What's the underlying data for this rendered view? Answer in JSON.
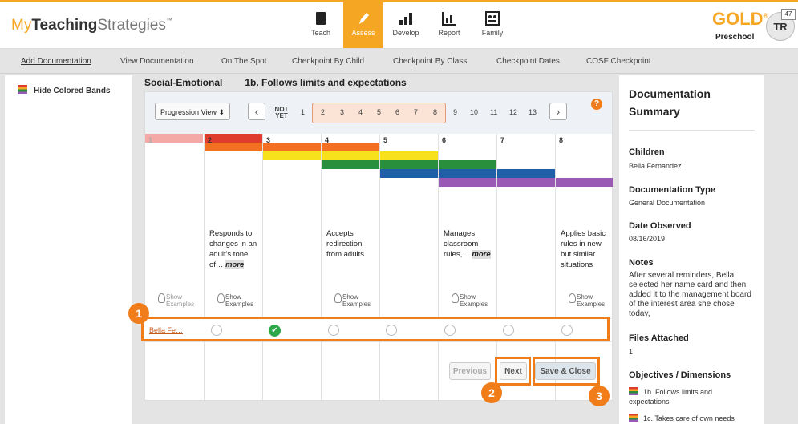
{
  "brand": {
    "my": "My",
    "teaching": "Teaching",
    "strategies": "Strategies",
    "tm": "™"
  },
  "nav": [
    {
      "label": "Teach",
      "icon": "book-icon"
    },
    {
      "label": "Assess",
      "icon": "pencil-icon",
      "active": true
    },
    {
      "label": "Develop",
      "icon": "bars-icon"
    },
    {
      "label": "Report",
      "icon": "chart-icon"
    },
    {
      "label": "Family",
      "icon": "family-icon"
    }
  ],
  "product": {
    "gold": "GOLD",
    "reg": "®",
    "level": "Preschool"
  },
  "user": {
    "initials": "TR",
    "badge": "47"
  },
  "subnav": [
    "Add Documentation",
    "View Documentation",
    "On The Spot",
    "Checkpoint By Child",
    "Checkpoint By Class",
    "Checkpoint Dates",
    "COSF Checkpoint"
  ],
  "sidebar": {
    "hide_bands": "Hide Colored Bands"
  },
  "heading": {
    "area": "Social-Emotional",
    "objective": "1b. Follows limits and expectations"
  },
  "controls": {
    "view": "Progression View",
    "not_yet": "NOT YET",
    "levels": [
      "1",
      "2",
      "3",
      "4",
      "5",
      "6",
      "7",
      "8",
      "9",
      "10",
      "11",
      "12",
      "13"
    ],
    "help": "?"
  },
  "columns": [
    {
      "num": "1",
      "desc": "",
      "show": "Show Examples"
    },
    {
      "num": "2",
      "desc": "Responds to changes in an adult's tone of…",
      "more": "more",
      "show": "Show Examples"
    },
    {
      "num": "3",
      "desc": "",
      "show": ""
    },
    {
      "num": "4",
      "desc": "Accepts redirection from adults",
      "show": "Show Examples"
    },
    {
      "num": "5",
      "desc": "",
      "show": ""
    },
    {
      "num": "6",
      "desc": "Manages classroom rules,…",
      "more": "more",
      "show": "Show Examples"
    },
    {
      "num": "7",
      "desc": "",
      "show": ""
    },
    {
      "num": "8",
      "desc": "Applies basic rules in new but similar situations",
      "show": "Show Examples"
    }
  ],
  "child": {
    "name": "Bella Fe…",
    "selected_level": "3"
  },
  "buttons": {
    "previous": "Previous",
    "next": "Next",
    "save_close": "Save & Close"
  },
  "callouts": [
    "1",
    "2",
    "3"
  ],
  "summary": {
    "title": "Documentation Summary",
    "children_h": "Children",
    "children_v": "Bella Fernandez",
    "doctype_h": "Documentation Type",
    "doctype_v": "General Documentation",
    "date_h": "Date Observed",
    "date_v": "08/16/2019",
    "notes_h": "Notes",
    "notes_v": "After several reminders, Bella selected her name card and then added it to the management board of the interest area she chose today,",
    "files_h": "Files Attached",
    "files_v": "1",
    "obj_h": "Objectives / Dimensions",
    "obj_items": [
      "1b. Follows limits and expectations",
      "1c. Takes care of own needs"
    ]
  },
  "colors": {
    "accent": "#f5a623",
    "highlight": "#f07d1a",
    "band_red": "#e03c2e",
    "band_orange": "#f36f21",
    "band_yellow": "#f7e01c",
    "band_green": "#2a8f3c",
    "band_blue": "#1f5fa8",
    "band_purple": "#9b59b6",
    "check": "#2aa84a"
  }
}
